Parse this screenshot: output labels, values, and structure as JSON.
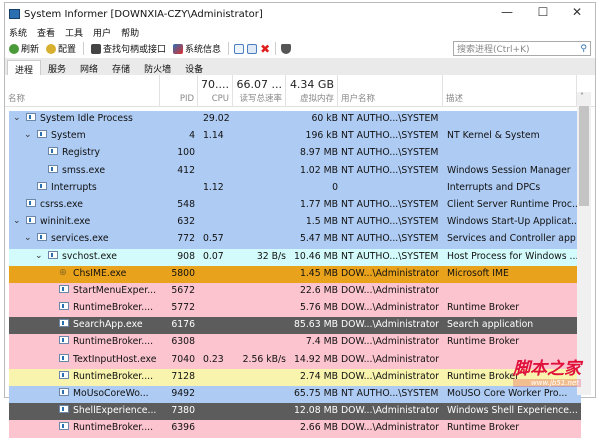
{
  "window": {
    "title": "System Informer [DOWNXIA-CZY\\Administrator]",
    "minimize": "—",
    "maximize": "☐",
    "close": "✕"
  },
  "menu": [
    "系统",
    "查看",
    "工具",
    "用户",
    "帮助"
  ],
  "toolbar": {
    "refresh": "刷新",
    "options": "配置",
    "find": "查找句柄或接口",
    "sysinfo": "系统信息"
  },
  "search": {
    "placeholder": "搜索进程(Ctrl+K)"
  },
  "tabs": [
    "进程",
    "服务",
    "网络",
    "存储",
    "防火墙",
    "设备"
  ],
  "columns": {
    "name": "名称",
    "pid": "PID",
    "cpu": "CPU",
    "cpu_total": "70....",
    "io": "读写总速率",
    "io_total": "66.07 ...",
    "mem": "虚拟内存",
    "mem_total": "4.34 GB",
    "user": "用户名称",
    "desc": "描述"
  },
  "colors": {
    "blue": "#aecbf3",
    "pink": "#fbc4cf",
    "cyan": "#d3fbfb",
    "orange": "#e9a21b",
    "dark": "#5c5c5c",
    "yellow": "#f8f3ad",
    "white": "#ffffff"
  },
  "rows": [
    {
      "name": "System Idle Process",
      "pid": "",
      "cpu": "29.02",
      "io": "",
      "mem": "60 kB",
      "user": "NT AUTHO...\\SYSTEM",
      "desc": "",
      "level": 0,
      "exp": true,
      "color": "blue"
    },
    {
      "name": "System",
      "pid": "4",
      "cpu": "1.14",
      "io": "",
      "mem": "196 kB",
      "user": "NT AUTHO...\\SYSTEM",
      "desc": "NT Kernel & System",
      "level": 1,
      "exp": true,
      "color": "blue"
    },
    {
      "name": "Registry",
      "pid": "100",
      "cpu": "",
      "io": "",
      "mem": "8.97 MB",
      "user": "NT AUTHO...\\SYSTEM",
      "desc": "",
      "level": 2,
      "exp": false,
      "color": "blue"
    },
    {
      "name": "smss.exe",
      "pid": "412",
      "cpu": "",
      "io": "",
      "mem": "1.02 MB",
      "user": "NT AUTHO...\\SYSTEM",
      "desc": "Windows Session Manager",
      "level": 2,
      "exp": false,
      "color": "blue"
    },
    {
      "name": "Interrupts",
      "pid": "",
      "cpu": "1.12",
      "io": "",
      "mem": "0",
      "user": "",
      "desc": "Interrupts and DPCs",
      "level": 1,
      "exp": false,
      "color": "blue"
    },
    {
      "name": "csrss.exe",
      "pid": "548",
      "cpu": "",
      "io": "",
      "mem": "1.77 MB",
      "user": "NT AUTHO...\\SYSTEM",
      "desc": "Client Server Runtime Proc...",
      "level": 0,
      "exp": false,
      "color": "blue"
    },
    {
      "name": "wininit.exe",
      "pid": "632",
      "cpu": "",
      "io": "",
      "mem": "1.5 MB",
      "user": "NT AUTHO...\\SYSTEM",
      "desc": "Windows Start-Up Applicat...",
      "level": 0,
      "exp": true,
      "color": "blue"
    },
    {
      "name": "services.exe",
      "pid": "772",
      "cpu": "0.57",
      "io": "",
      "mem": "5.47 MB",
      "user": "NT AUTHO...\\SYSTEM",
      "desc": "Services and Controller app",
      "level": 1,
      "exp": true,
      "color": "blue"
    },
    {
      "name": "svchost.exe",
      "pid": "908",
      "cpu": "0.07",
      "io": "32 B/s",
      "mem": "10.46 MB",
      "user": "NT AUTHO...\\SYSTEM",
      "desc": "Host Process for Windows ...",
      "level": 2,
      "exp": true,
      "color": "cyan"
    },
    {
      "name": "ChsIME.exe",
      "pid": "5800",
      "cpu": "",
      "io": "",
      "mem": "1.45 MB",
      "user": "DOW...\\Administrator",
      "desc": "Microsoft IME",
      "level": 3,
      "exp": false,
      "color": "orange",
      "ime": true
    },
    {
      "name": "StartMenuExper...",
      "pid": "5672",
      "cpu": "",
      "io": "",
      "mem": "22.6 MB",
      "user": "DOW...\\Administrator",
      "desc": "",
      "level": 3,
      "exp": false,
      "color": "pink"
    },
    {
      "name": "RuntimeBroker....",
      "pid": "5772",
      "cpu": "",
      "io": "",
      "mem": "5.76 MB",
      "user": "DOW...\\Administrator",
      "desc": "Runtime Broker",
      "level": 3,
      "exp": false,
      "color": "pink"
    },
    {
      "name": "SearchApp.exe",
      "pid": "6176",
      "cpu": "",
      "io": "",
      "mem": "85.63 MB",
      "user": "DOW...\\Administrator",
      "desc": "Search application",
      "level": 3,
      "exp": false,
      "color": "dark"
    },
    {
      "name": "RuntimeBroker....",
      "pid": "6308",
      "cpu": "",
      "io": "",
      "mem": "7.4 MB",
      "user": "DOW...\\Administrator",
      "desc": "Runtime Broker",
      "level": 3,
      "exp": false,
      "color": "pink"
    },
    {
      "name": "TextInputHost.exe",
      "pid": "7040",
      "cpu": "0.23",
      "io": "2.56 kB/s",
      "mem": "14.92 MB",
      "user": "DOW...\\Administrator",
      "desc": "",
      "level": 3,
      "exp": false,
      "color": "pink"
    },
    {
      "name": "RuntimeBroker....",
      "pid": "7128",
      "cpu": "",
      "io": "",
      "mem": "2.74 MB",
      "user": "DOW...\\Administrator",
      "desc": "Runtime Broker",
      "level": 3,
      "exp": false,
      "color": "yellow"
    },
    {
      "name": "MoUsoCoreWo...",
      "pid": "9492",
      "cpu": "",
      "io": "",
      "mem": "65.75 MB",
      "user": "NT AUTHO...\\SYSTEM",
      "desc": "MoUSO Core Worker Pro...",
      "level": 3,
      "exp": false,
      "color": "blue"
    },
    {
      "name": "ShellExperience...",
      "pid": "7380",
      "cpu": "",
      "io": "",
      "mem": "12.08 MB",
      "user": "DOW...\\Administrator",
      "desc": "Windows Shell Experience...",
      "level": 3,
      "exp": false,
      "color": "dark"
    },
    {
      "name": "RuntimeBroker....",
      "pid": "6396",
      "cpu": "",
      "io": "",
      "mem": "2.66 MB",
      "user": "DOW...\\Administrator",
      "desc": "Runtime Broker",
      "level": 3,
      "exp": false,
      "color": "pink"
    }
  ],
  "watermark": {
    "name": "脚本之家",
    "url": "www.jb51.net"
  }
}
